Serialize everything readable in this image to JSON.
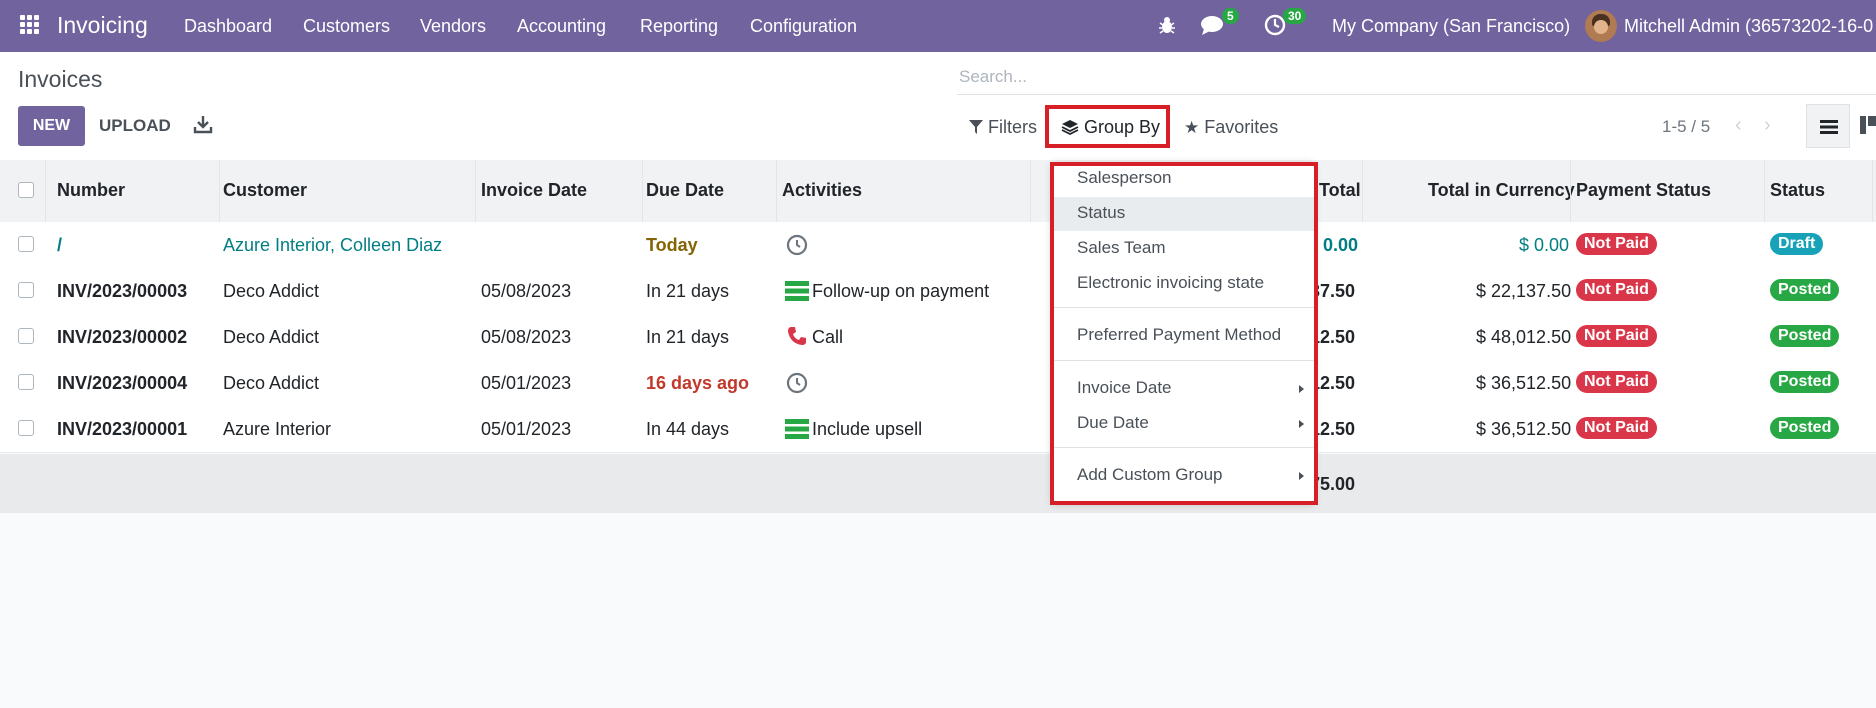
{
  "navbar": {
    "app_title": "Invoicing",
    "menu": [
      "Dashboard",
      "Customers",
      "Vendors",
      "Accounting",
      "Reporting",
      "Configuration"
    ],
    "messages_count": "5",
    "activities_count": "30",
    "company": "My Company (San Francisco)",
    "user": "Mitchell Admin (36573202-16-0"
  },
  "control": {
    "breadcrumb": "Invoices",
    "new_label": "NEW",
    "upload_label": "UPLOAD",
    "search_placeholder": "Search...",
    "filters_label": "Filters",
    "groupby_label": "Group By",
    "favorites_label": "Favorites",
    "pager": "1-5 / 5"
  },
  "table": {
    "headers": {
      "number": "Number",
      "customer": "Customer",
      "invoice_date": "Invoice Date",
      "due_date": "Due Date",
      "activities": "Activities",
      "total": "Total",
      "total_currency": "Total in Currency",
      "payment_status": "Payment Status",
      "status": "Status"
    },
    "rows": [
      {
        "number": "/",
        "customer": "Azure Interior, Colleen Diaz",
        "invoice_date": "",
        "due_date": "Today",
        "activity": "",
        "total": "0.00",
        "total_currency": "$ 0.00",
        "payment_status": "Not Paid",
        "status": "Draft"
      },
      {
        "number": "INV/2023/00003",
        "customer": "Deco Addict",
        "invoice_date": "05/08/2023",
        "due_date": "In 21 days",
        "activity": "Follow-up on payment",
        "total": "37.50",
        "total_currency": "$ 22,137.50",
        "payment_status": "Not Paid",
        "status": "Posted"
      },
      {
        "number": "INV/2023/00002",
        "customer": "Deco Addict",
        "invoice_date": "05/08/2023",
        "due_date": "In 21 days",
        "activity": "Call",
        "total": "12.50",
        "total_currency": "$ 48,012.50",
        "payment_status": "Not Paid",
        "status": "Posted"
      },
      {
        "number": "INV/2023/00004",
        "customer": "Deco Addict",
        "invoice_date": "05/01/2023",
        "due_date": "16 days ago",
        "activity": "",
        "total": "12.50",
        "total_currency": "$ 36,512.50",
        "payment_status": "Not Paid",
        "status": "Posted"
      },
      {
        "number": "INV/2023/00001",
        "customer": "Azure Interior",
        "invoice_date": "05/01/2023",
        "due_date": "In 44 days",
        "activity": "Include upsell",
        "total": "12.50",
        "total_currency": "$ 36,512.50",
        "payment_status": "Not Paid",
        "status": "Posted"
      }
    ],
    "footer_total": "75.00"
  },
  "groupby_menu": {
    "items": [
      "Salesperson",
      "Status",
      "Sales Team",
      "Electronic invoicing state"
    ],
    "preferred": "Preferred Payment Method",
    "date_items": [
      "Invoice Date",
      "Due Date"
    ],
    "custom": "Add Custom Group"
  },
  "colors": {
    "brand": "#71639e",
    "not_paid": "#d9364a",
    "posted": "#28a745",
    "draft": "#17a2b8",
    "highlight_border": "#d61f26"
  }
}
